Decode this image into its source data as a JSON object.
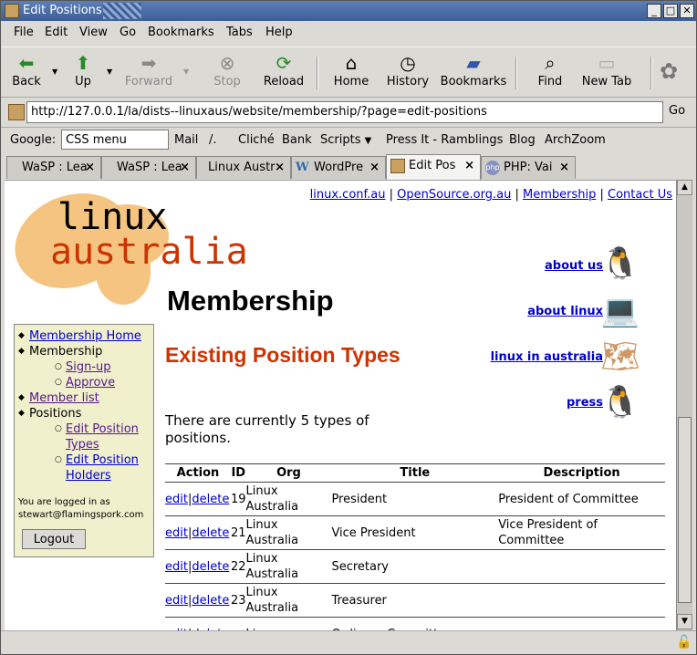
{
  "window": {
    "title": "Edit Positions"
  },
  "menu": [
    "File",
    "Edit",
    "View",
    "Go",
    "Bookmarks",
    "Tabs",
    "Help"
  ],
  "toolbar": {
    "back": "Back",
    "up": "Up",
    "forward": "Forward",
    "stop": "Stop",
    "reload": "Reload",
    "home": "Home",
    "history": "History",
    "bookmarks": "Bookmarks",
    "find": "Find",
    "newtab": "New Tab"
  },
  "url": {
    "value": "http://127.0.0.1/la/dists--linuxaus/website/membership/?page=edit-positions",
    "go": "Go"
  },
  "personal_bar": {
    "google_label": "Google:",
    "google_value": "CSS menu",
    "items": [
      "Mail",
      "/.",
      "Cliché",
      "Bank",
      "Scripts",
      "Press It - Ramblings",
      "Blog",
      "ArchZoom"
    ]
  },
  "tabs": [
    "WaSP : Lea",
    "WaSP : Lea",
    "Linux Austr",
    "WordPre",
    "Edit Pos",
    "PHP: Vai"
  ],
  "page": {
    "toplinks": [
      "linux.conf.au",
      "OpenSource.org.au",
      "Membership",
      "Contact Us"
    ],
    "logo_top": "linux",
    "logo_bottom": "australia",
    "heading": "Membership",
    "subheading": "Existing Position Types",
    "intro": "There are currently 5 types of positions.",
    "side": [
      "about us",
      "about linux",
      "linux in australia",
      "press"
    ],
    "nav": {
      "home": "Membership Home",
      "membership": "Membership",
      "signup": "Sign-up",
      "approve": "Approve",
      "memberlist": "Member list",
      "positions": "Positions",
      "edit_types": "Edit Position Types",
      "edit_holders": "Edit Position Holders",
      "logged_in": "You are logged in as stewart@flamingspork.com",
      "logout": "Logout"
    },
    "table": {
      "headers": [
        "Action",
        "ID",
        "Org",
        "Title",
        "Description"
      ],
      "edit": "edit",
      "sep": "|",
      "delete": "delete",
      "rows": [
        {
          "id": "19",
          "org": "Linux Australia",
          "title": "President",
          "desc": "President of Committee"
        },
        {
          "id": "21",
          "org": "Linux Australia",
          "title": "Vice President",
          "desc": "Vice President of Committee"
        },
        {
          "id": "22",
          "org": "Linux Australia",
          "title": "Secretary",
          "desc": ""
        },
        {
          "id": "23",
          "org": "Linux Australia",
          "title": "Treasurer",
          "desc": ""
        },
        {
          "id": "",
          "org": "Linux",
          "title": "Ordinary Committee",
          "desc": ""
        }
      ]
    }
  }
}
